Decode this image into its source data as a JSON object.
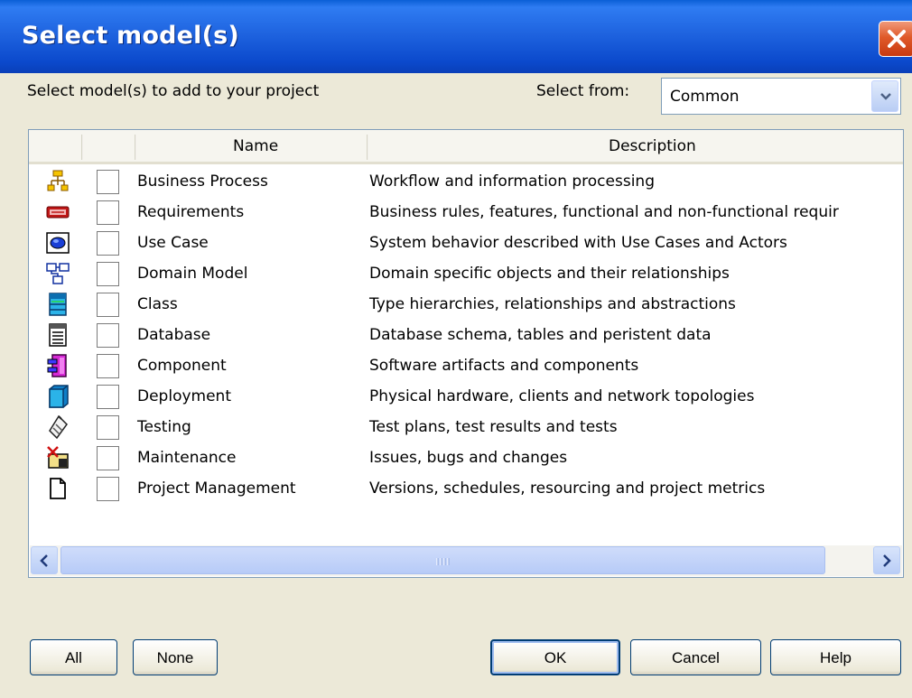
{
  "window": {
    "title": "Select model(s)"
  },
  "instruction": "Select model(s) to add to your project",
  "select_from": {
    "label": "Select from:",
    "value": "Common"
  },
  "columns": {
    "name": "Name",
    "description": "Description"
  },
  "models": [
    {
      "icon": "business-process-icon",
      "name": "Business Process",
      "description": "Workflow and information processing"
    },
    {
      "icon": "requirements-icon",
      "name": "Requirements",
      "description": "Business rules, features, functional and non-functional requir"
    },
    {
      "icon": "use-case-icon",
      "name": "Use Case",
      "description": "System behavior described with Use Cases and Actors"
    },
    {
      "icon": "domain-model-icon",
      "name": "Domain Model",
      "description": "Domain specific objects and their relationships"
    },
    {
      "icon": "class-icon",
      "name": "Class",
      "description": "Type hierarchies, relationships and abstractions"
    },
    {
      "icon": "database-icon",
      "name": "Database",
      "description": "Database schema, tables and peristent data"
    },
    {
      "icon": "component-icon",
      "name": "Component",
      "description": "Software artifacts and components"
    },
    {
      "icon": "deployment-icon",
      "name": "Deployment",
      "description": "Physical hardware, clients and network topologies"
    },
    {
      "icon": "testing-icon",
      "name": "Testing",
      "description": "Test plans, test results and tests"
    },
    {
      "icon": "maintenance-icon",
      "name": "Maintenance",
      "description": "Issues, bugs and changes"
    },
    {
      "icon": "project-management-icon",
      "name": "Project Management",
      "description": "Versions, schedules, resourcing and project metrics"
    }
  ],
  "buttons": {
    "all": "All",
    "none": "None",
    "ok": "OK",
    "cancel": "Cancel",
    "help": "Help"
  },
  "colors": {
    "titlebar": "#0a5fd6",
    "close": "#e05a2a",
    "dialog_bg": "#ece9d8",
    "border": "#7f9db9"
  }
}
